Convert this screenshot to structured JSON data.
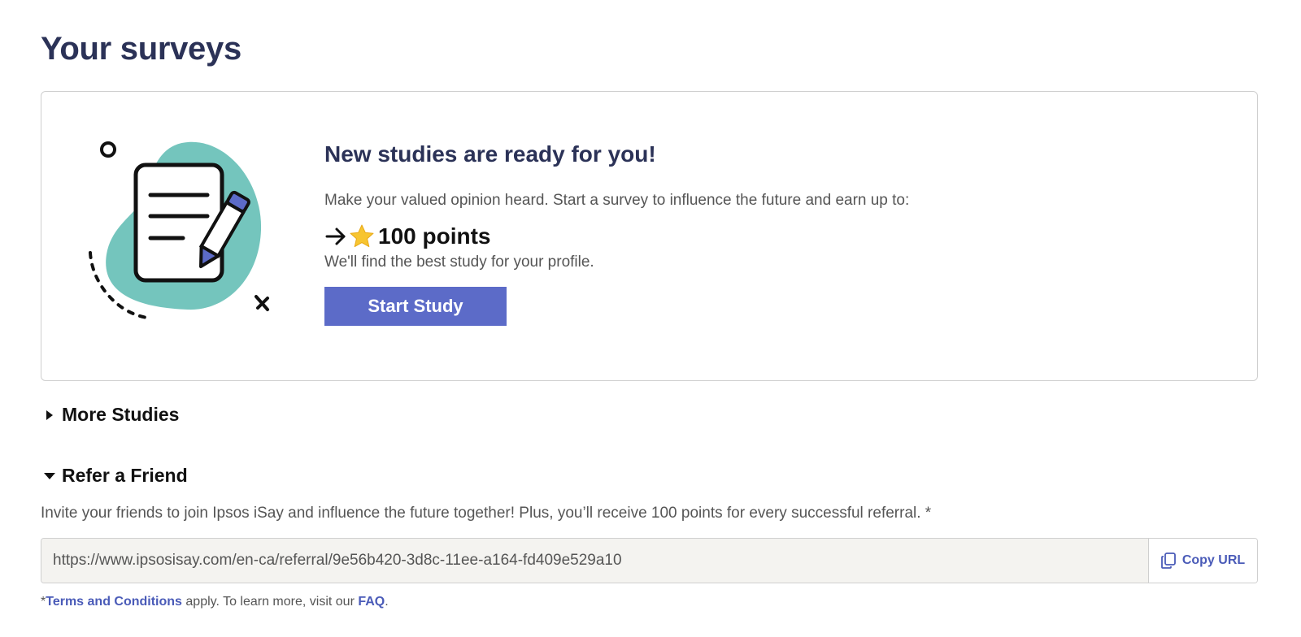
{
  "page": {
    "title": "Your surveys"
  },
  "study_card": {
    "illustration_icon": "document-with-pencil-illustration",
    "heading": "New studies are ready for you!",
    "description": "Make your valued opinion heard. Start a survey to influence the future and earn up to:",
    "points_arrow_icon": "arrow-right-icon",
    "points_star_icon": "star-icon",
    "points_label": "100 points",
    "subtext": "We'll find the best study for your profile.",
    "button_label": "Start Study"
  },
  "more_studies": {
    "label": "More Studies",
    "expanded": false,
    "caret_icon": "caret-right-icon"
  },
  "refer_friend": {
    "label": "Refer a Friend",
    "expanded": true,
    "caret_icon": "caret-down-icon",
    "description": "Invite your friends to join Ipsos iSay and influence the future together! Plus, you’ll receive 100 points for every successful referral. *",
    "referral_url": "https://www.ipsosisay.com/en-ca/referral/9e56b420-3d8c-11ee-a164-fd409e529a10",
    "copy_icon": "copy-icon",
    "copy_label": "Copy URL"
  },
  "footnote": {
    "prefix": "*",
    "terms_link": "Terms and Conditions",
    "middle": " apply. To learn more, visit our ",
    "faq_link": "FAQ",
    "suffix": "."
  },
  "colors": {
    "heading": "#2b3257",
    "accent": "#5c6bc8",
    "link": "#4a5bb8",
    "blob": "#74c5bd",
    "star": "#f7c531",
    "input_bg": "#f4f3f0"
  }
}
